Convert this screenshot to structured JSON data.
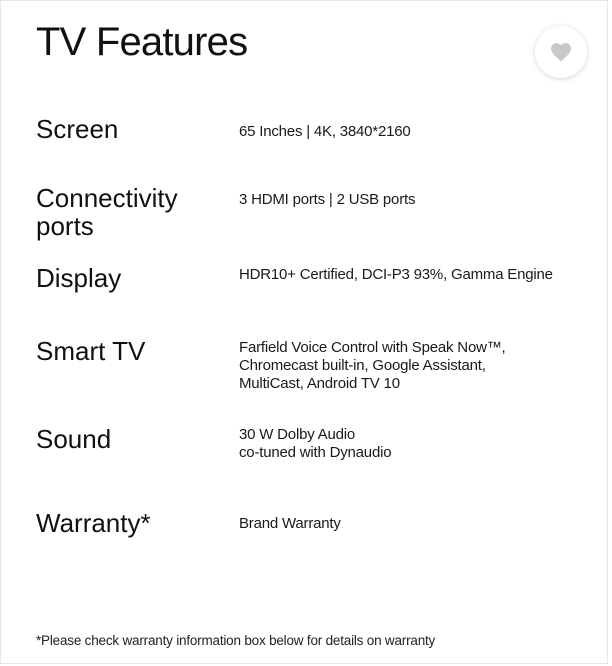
{
  "page": {
    "title": "TV Features",
    "favorite_icon": "heart-icon"
  },
  "features": [
    {
      "label": "Screen",
      "value_lines": [
        "65 Inches | 4K, 3840*2160"
      ]
    },
    {
      "label_lines": [
        "Connectivity",
        "ports"
      ],
      "value_lines": [
        "3 HDMI ports | 2 USB ports"
      ]
    },
    {
      "label": "Display",
      "value_lines": [
        "HDR10+ Certified, DCI-P3 93%, Gamma Engine"
      ]
    },
    {
      "label": "Smart TV",
      "value_lines": [
        "Farfield Voice Control with Speak Now™,",
        "Chromecast built-in, Google Assistant,",
        "MultiCast, Android TV 10"
      ]
    },
    {
      "label": "Sound",
      "value_lines": [
        "30 W Dolby Audio",
        "co-tuned with Dynaudio"
      ]
    },
    {
      "label": "Warranty*",
      "value_lines": [
        "Brand Warranty"
      ]
    }
  ],
  "footnote": "*Please check warranty information box below for details on warranty",
  "colors": {
    "text": "#111111",
    "heart": "#c8c8c8"
  }
}
